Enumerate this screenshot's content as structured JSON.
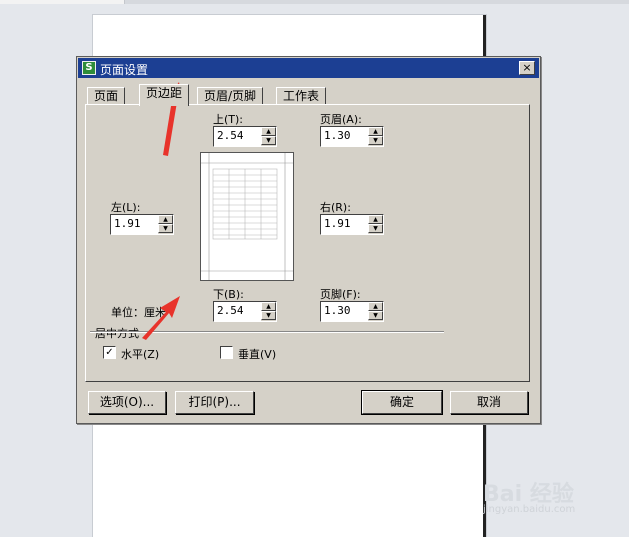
{
  "dialog": {
    "title": "页面设置",
    "app_icon": "S",
    "close": "×"
  },
  "tabs": [
    {
      "label": "页面",
      "active": false
    },
    {
      "label": "页边距",
      "active": true
    },
    {
      "label": "页眉/页脚",
      "active": false
    },
    {
      "label": "工作表",
      "active": false
    }
  ],
  "margins": {
    "top_label": "上(T):",
    "top_value": "2.54",
    "header_label": "页眉(A):",
    "header_value": "1.30",
    "left_label": "左(L):",
    "left_value": "1.91",
    "right_label": "右(R):",
    "right_value": "1.91",
    "bottom_label": "下(B):",
    "bottom_value": "2.54",
    "footer_label": "页脚(F):",
    "footer_value": "1.30",
    "unit_label": "单位：厘米"
  },
  "center": {
    "group_label": "居中方式",
    "horizontal_label": "水平(Z)",
    "horizontal_checked": true,
    "horizontal_mark": "✓",
    "vertical_label": "垂直(V)",
    "vertical_checked": false
  },
  "buttons": {
    "options": "选项(O)...",
    "print": "打印(P)...",
    "ok": "确定",
    "cancel": "取消"
  },
  "watermark": {
    "brand": "Bai 经验",
    "url": "jingyan.baidu.com"
  },
  "colors": {
    "titlebar": "#1c3f93",
    "dialog_bg": "#d5d1c8",
    "annotation_arrow": "#e8332b"
  }
}
